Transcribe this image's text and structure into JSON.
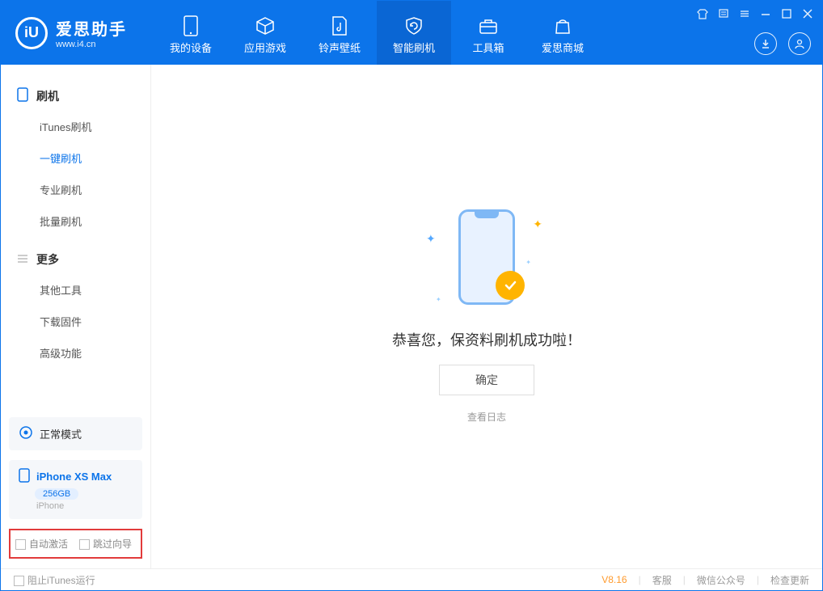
{
  "app": {
    "logo_letter": "iU",
    "title": "爱思助手",
    "subtitle": "www.i4.cn"
  },
  "tabs": {
    "device": "我的设备",
    "apps": "应用游戏",
    "ring": "铃声壁纸",
    "flash": "智能刷机",
    "tools": "工具箱",
    "store": "爱思商城"
  },
  "sidebar": {
    "group_flash": "刷机",
    "itunes_flash": "iTunes刷机",
    "oneclick_flash": "一键刷机",
    "pro_flash": "专业刷机",
    "batch_flash": "批量刷机",
    "group_more": "更多",
    "other_tools": "其他工具",
    "download_fw": "下载固件",
    "advanced": "高级功能"
  },
  "device_panel": {
    "mode": "正常模式",
    "name": "iPhone XS Max",
    "storage": "256GB",
    "type": "iPhone"
  },
  "checkboxes": {
    "auto_activate": "自动激活",
    "skip_guide": "跳过向导"
  },
  "main": {
    "success_text": "恭喜您，保资料刷机成功啦！",
    "ok_button": "确定",
    "view_log": "查看日志"
  },
  "footer": {
    "block_itunes": "阻止iTunes运行",
    "version": "V8.16",
    "support": "客服",
    "wechat": "微信公众号",
    "check_update": "检查更新"
  }
}
